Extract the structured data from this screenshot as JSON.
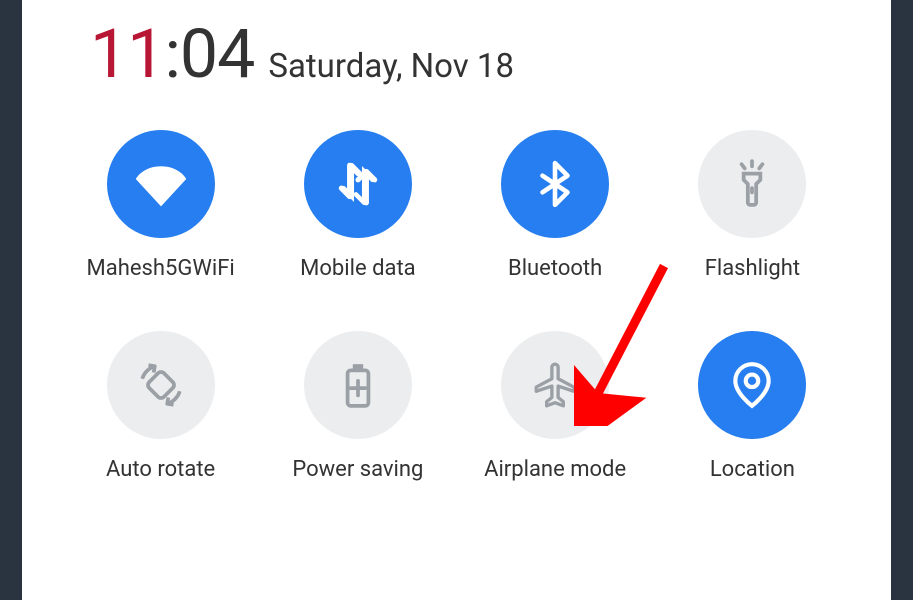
{
  "clock": {
    "hours": "11",
    "separator": ":",
    "minutes": "04"
  },
  "date": "Saturday, Nov 18",
  "tiles": [
    {
      "id": "wifi",
      "label": "Mahesh5GWiFi",
      "active": true
    },
    {
      "id": "mobile-data",
      "label": "Mobile data",
      "active": true
    },
    {
      "id": "bluetooth",
      "label": "Bluetooth",
      "active": true
    },
    {
      "id": "flashlight",
      "label": "Flashlight",
      "active": false
    },
    {
      "id": "auto-rotate",
      "label": "Auto rotate",
      "active": false
    },
    {
      "id": "power-saving",
      "label": "Power saving",
      "active": false
    },
    {
      "id": "airplane-mode",
      "label": "Airplane mode",
      "active": false
    },
    {
      "id": "location",
      "label": "Location",
      "active": true
    }
  ],
  "annotation": {
    "target": "airplane-mode",
    "type": "arrow",
    "color": "#ff0000"
  }
}
